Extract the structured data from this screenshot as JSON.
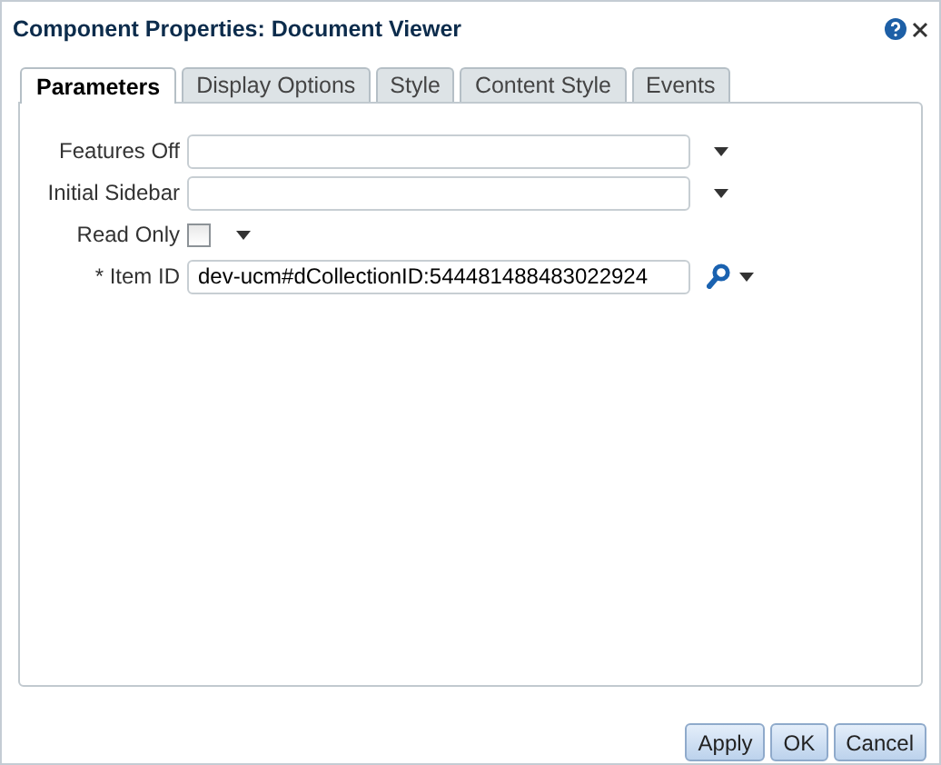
{
  "window": {
    "title": "Component Properties: Document Viewer"
  },
  "tabs": [
    {
      "label": "Parameters",
      "selected": true
    },
    {
      "label": "Display Options",
      "selected": false
    },
    {
      "label": "Style",
      "selected": false
    },
    {
      "label": "Content Style",
      "selected": false
    },
    {
      "label": "Events",
      "selected": false
    }
  ],
  "fields": [
    {
      "kind": "text",
      "label": "Features Off"
    },
    {
      "kind": "text",
      "label": "Initial Sidebar"
    },
    {
      "kind": "checkbox",
      "label": "Read Only",
      "checked": false
    },
    {
      "kind": "lookup",
      "label": "* Item ID",
      "value": "dev-ucm#dCollectionID:544481488483022924"
    }
  ],
  "buttons": [
    "Apply",
    "OK",
    "Cancel"
  ]
}
